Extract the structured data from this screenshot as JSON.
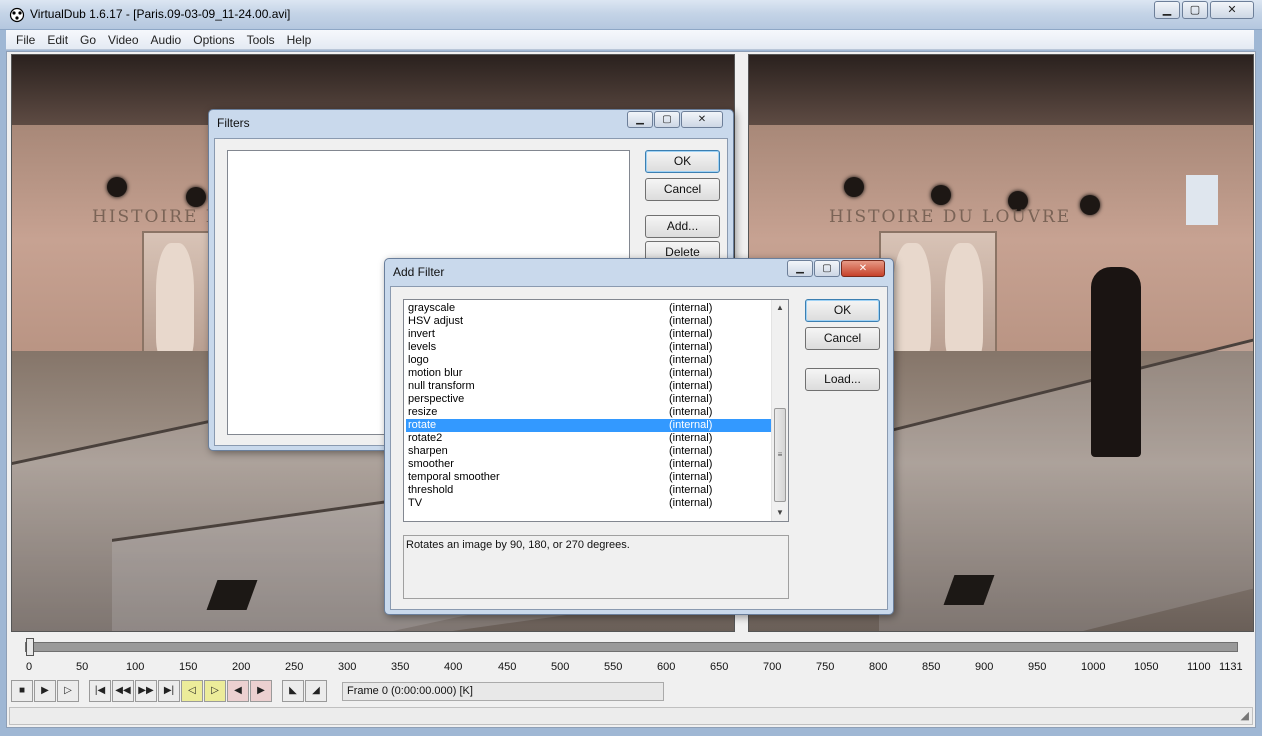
{
  "window": {
    "title": "VirtualDub 1.6.17 - [Paris.09-03-09_11-24.00.avi]",
    "controls": {
      "minimize": "▁",
      "maximize": "▢",
      "close": "✕"
    }
  },
  "menu": [
    "File",
    "Edit",
    "Go",
    "Video",
    "Audio",
    "Options",
    "Tools",
    "Help"
  ],
  "video": {
    "wall_text_left": "HISTOIRE D",
    "wall_text_right": "HISTOIRE  DU LOUVRE"
  },
  "timeline": {
    "ticks": [
      "0",
      "50",
      "100",
      "150",
      "200",
      "250",
      "300",
      "350",
      "400",
      "450",
      "500",
      "550",
      "600",
      "650",
      "700",
      "750",
      "800",
      "850",
      "900",
      "950",
      "1000",
      "1050",
      "1100",
      "1131"
    ],
    "position_frame": 0,
    "total_frames": 1131
  },
  "frame_status": "Frame 0 (0:00:00.000) [K]",
  "toolbar_icons": [
    "stop-icon",
    "play-input-icon",
    "play-output-icon",
    "start-icon",
    "prev-frame-icon",
    "next-frame-icon",
    "end-icon",
    "prev-keyframe-icon",
    "next-keyframe-icon",
    "scene-back-icon",
    "scene-forward-icon",
    "mark-in-icon",
    "mark-out-icon"
  ],
  "filters_dialog": {
    "title": "Filters",
    "ok": "OK",
    "cancel": "Cancel",
    "add": "Add...",
    "delete": "Delete"
  },
  "add_filter_dialog": {
    "title": "Add Filter",
    "ok": "OK",
    "cancel": "Cancel",
    "load": "Load...",
    "filters": [
      {
        "name": "grayscale",
        "type": "(internal)"
      },
      {
        "name": "HSV adjust",
        "type": "(internal)"
      },
      {
        "name": "invert",
        "type": "(internal)"
      },
      {
        "name": "levels",
        "type": "(internal)"
      },
      {
        "name": "logo",
        "type": "(internal)"
      },
      {
        "name": "motion blur",
        "type": "(internal)"
      },
      {
        "name": "null transform",
        "type": "(internal)"
      },
      {
        "name": "perspective",
        "type": "(internal)"
      },
      {
        "name": "resize",
        "type": "(internal)"
      },
      {
        "name": "rotate",
        "type": "(internal)",
        "selected": true
      },
      {
        "name": "rotate2",
        "type": "(internal)"
      },
      {
        "name": "sharpen",
        "type": "(internal)"
      },
      {
        "name": "smoother",
        "type": "(internal)"
      },
      {
        "name": "temporal smoother",
        "type": "(internal)"
      },
      {
        "name": "threshold",
        "type": "(internal)"
      },
      {
        "name": "TV",
        "type": "(internal)"
      }
    ],
    "description": "Rotates an image by 90, 180, or 270 degrees.",
    "selection_color": "#3399ff"
  }
}
